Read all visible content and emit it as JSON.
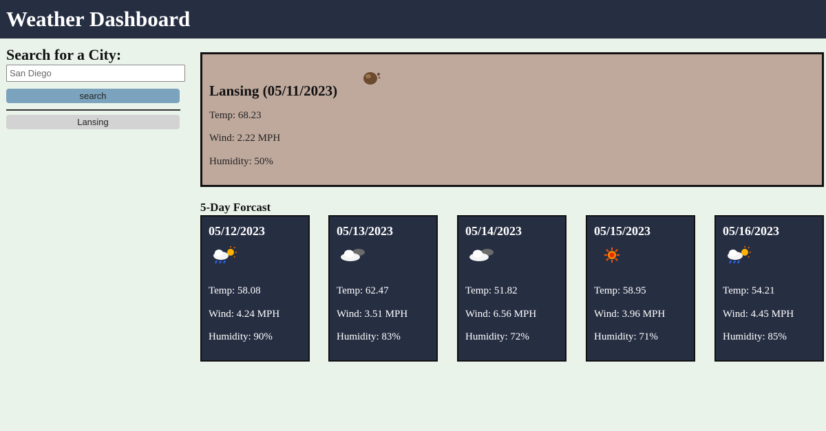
{
  "header": {
    "title": "Weather Dashboard"
  },
  "sidebar": {
    "heading": "Search for a City:",
    "search_value": "San Diego",
    "search_label": "search",
    "history": [
      "Lansing"
    ]
  },
  "current": {
    "city_date": "Lansing (05/11/2023)",
    "icon": "hazy-icon",
    "temp": "Temp: 68.23",
    "wind": "Wind: 2.22 MPH",
    "humidity": "Humidity: 50%"
  },
  "forecast": {
    "title": "5-Day Forcast",
    "days": [
      {
        "date": "05/12/2023",
        "icon": "rain-sun-icon",
        "temp": "Temp: 58.08",
        "wind": "Wind: 4.24 MPH",
        "humidity": "Humidity: 90%"
      },
      {
        "date": "05/13/2023",
        "icon": "cloudy-icon",
        "temp": "Temp: 62.47",
        "wind": "Wind: 3.51 MPH",
        "humidity": "Humidity: 83%"
      },
      {
        "date": "05/14/2023",
        "icon": "cloudy-icon",
        "temp": "Temp: 51.82",
        "wind": "Wind: 6.56 MPH",
        "humidity": "Humidity: 72%"
      },
      {
        "date": "05/15/2023",
        "icon": "sun-icon",
        "temp": "Temp: 58.95",
        "wind": "Wind: 3.96 MPH",
        "humidity": "Humidity: 71%"
      },
      {
        "date": "05/16/2023",
        "icon": "rain-sun-icon",
        "temp": "Temp: 54.21",
        "wind": "Wind: 4.45 MPH",
        "humidity": "Humidity: 85%"
      }
    ]
  },
  "colors": {
    "header_bg": "#262e42",
    "page_bg": "#eaf3ea",
    "current_bg": "#bfa99d",
    "search_btn": "#7ba3bd",
    "history_btn": "#d3d3d3"
  }
}
